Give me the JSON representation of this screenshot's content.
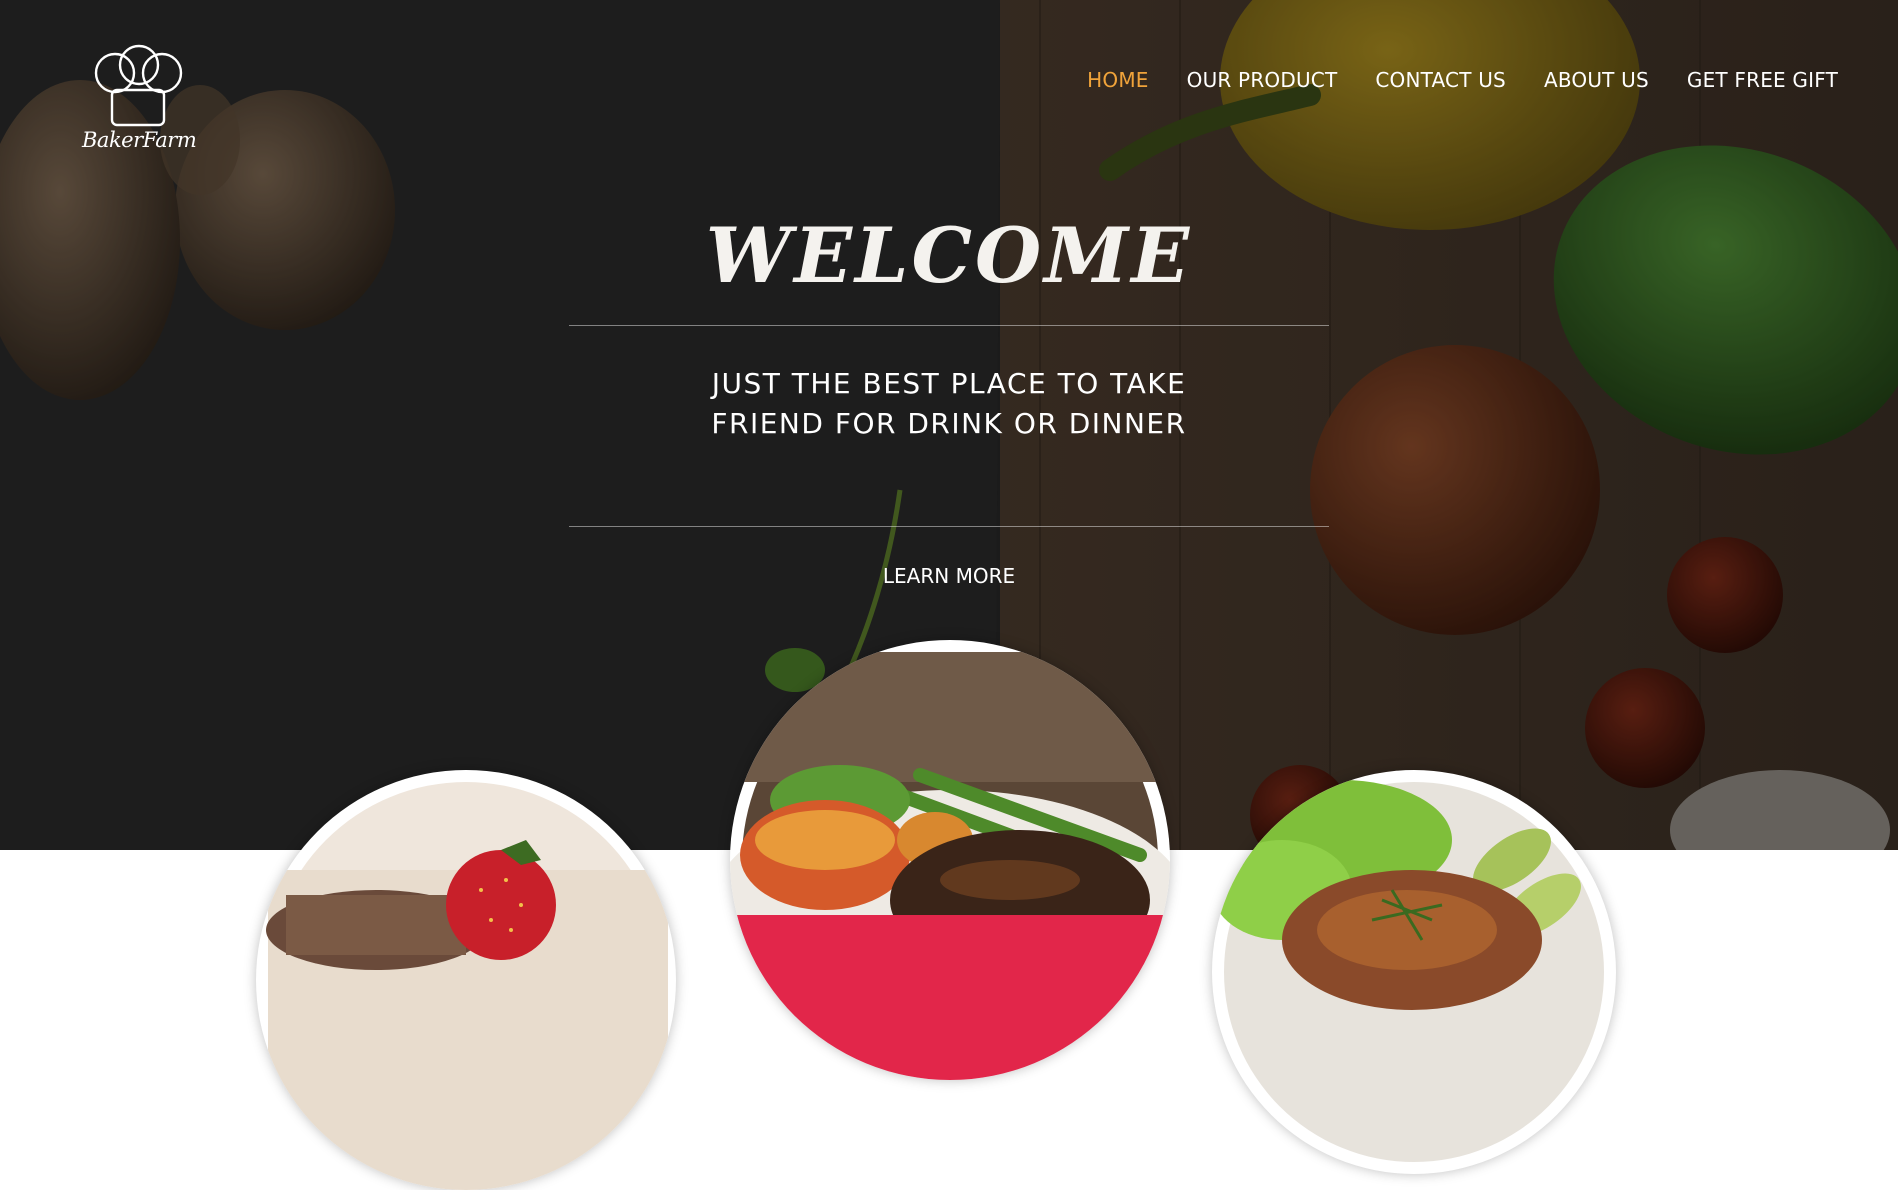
{
  "brand": {
    "name": "BakerFarm"
  },
  "nav": {
    "items": [
      {
        "label": "HOME",
        "active": true
      },
      {
        "label": "OUR PRODUCT",
        "active": false
      },
      {
        "label": "CONTACT US",
        "active": false
      },
      {
        "label": "ABOUT US",
        "active": false
      },
      {
        "label": "GET FREE GIFT",
        "active": false
      }
    ],
    "active_color": "#f0a33a"
  },
  "hero": {
    "title": "WELCOME",
    "tagline": "JUST THE BEST PLACE TO TAKE FRIEND FOR DRINK OR DINNER",
    "cta_label": "LEARN MORE"
  },
  "gallery": {
    "items": [
      {
        "name": "dessert-strawberry-image"
      },
      {
        "name": "steak-asparagus-image"
      },
      {
        "name": "salmon-salad-image"
      }
    ]
  },
  "colors": {
    "accent": "#f0a33a",
    "text_light": "#ffffff",
    "plate_band": "#e2264a"
  }
}
